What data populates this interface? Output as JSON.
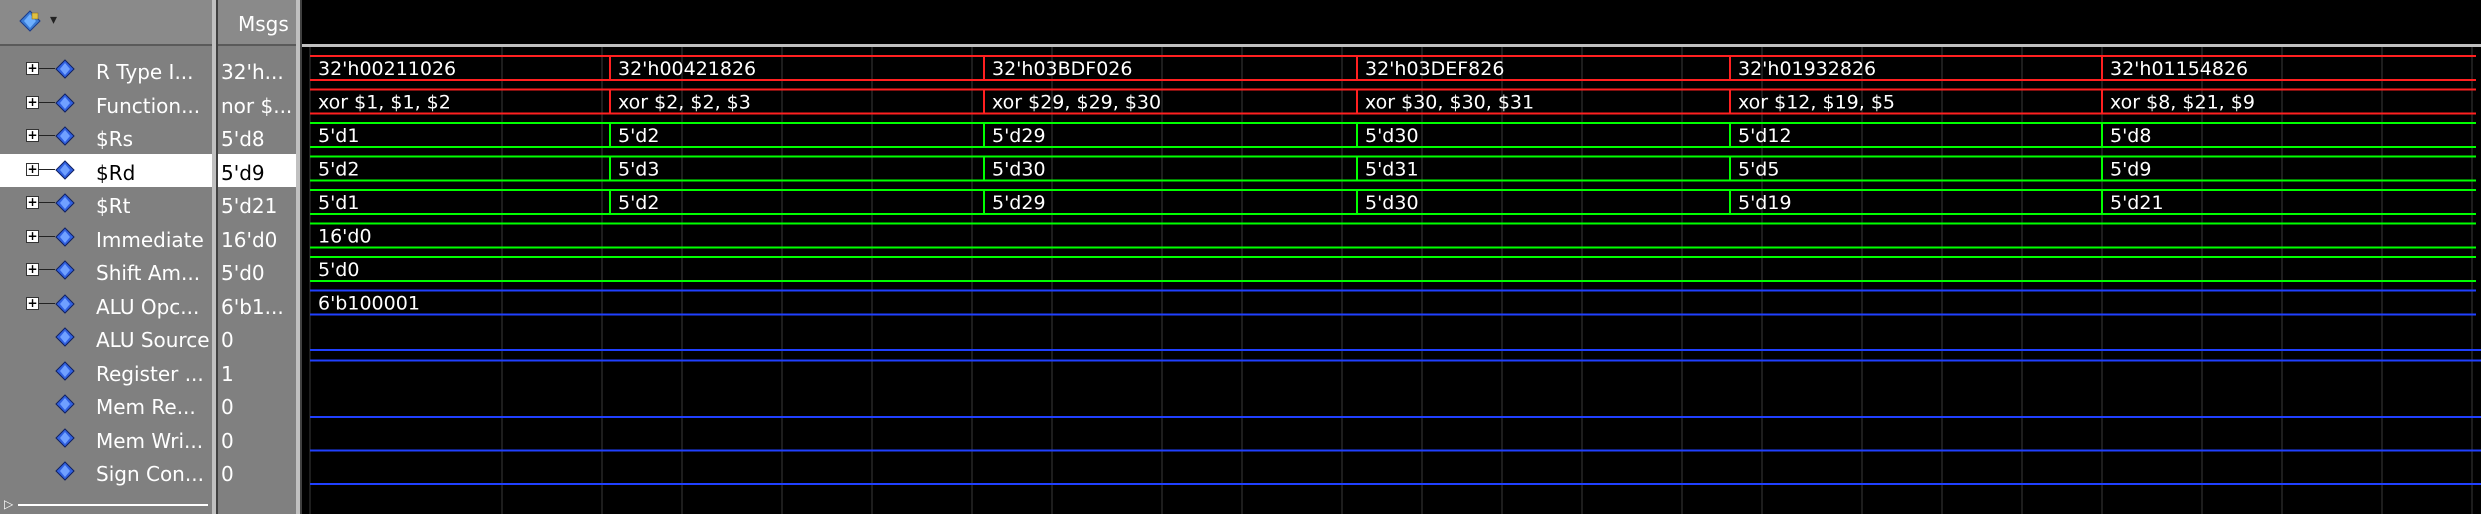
{
  "header": {
    "msgs_label": "Msgs",
    "toolbar_icon": "wave-diamond-icon"
  },
  "signals": [
    {
      "name": "R Type I...",
      "value": "32'h...",
      "expandable": true,
      "color": "#ff2020"
    },
    {
      "name": "Function...",
      "value": "nor $...",
      "expandable": true,
      "color": "#ff2020"
    },
    {
      "name": "$Rs",
      "value": "5'd8",
      "expandable": true,
      "color": "#00ff00"
    },
    {
      "name": "$Rd",
      "value": "5'd9",
      "expandable": true,
      "color": "#00ff00",
      "selected": true
    },
    {
      "name": "$Rt",
      "value": "5'd21",
      "expandable": true,
      "color": "#00ff00"
    },
    {
      "name": "Immediate",
      "value": "16'd0",
      "expandable": true,
      "color": "#00ff00"
    },
    {
      "name": "Shift Am...",
      "value": "5'd0",
      "expandable": true,
      "color": "#00ff00"
    },
    {
      "name": "ALU Opc...",
      "value": "6'b1...",
      "expandable": true,
      "color": "#2040ff"
    },
    {
      "name": "ALU Source",
      "value": "0",
      "expandable": false,
      "color": "#2040ff"
    },
    {
      "name": "Register ...",
      "value": "1",
      "expandable": false,
      "color": "#2040ff"
    },
    {
      "name": "Mem Re...",
      "value": "0",
      "expandable": false,
      "color": "#2040ff"
    },
    {
      "name": "Mem Wri...",
      "value": "0",
      "expandable": false,
      "color": "#2040ff"
    },
    {
      "name": "Sign Con...",
      "value": "0",
      "expandable": false,
      "color": "#2040ff"
    }
  ],
  "waves": [
    {
      "color": "#ff2020",
      "segments": [
        "32'h00211026",
        "32'h00421826",
        "32'h03BDF026",
        "32'h03DEF826",
        "32'h01932826",
        "32'h01154826"
      ]
    },
    {
      "color": "#ff2020",
      "segments": [
        "xor $1, $1, $2",
        "xor $2, $2, $3",
        "xor $29, $29, $30",
        "xor $30, $30, $31",
        "xor $12, $19, $5",
        "xor $8, $21, $9"
      ]
    },
    {
      "color": "#00ff00",
      "segments": [
        "5'd1",
        "5'd2",
        "5'd29",
        "5'd30",
        "5'd12",
        "5'd8"
      ]
    },
    {
      "color": "#00ff00",
      "segments": [
        "5'd2",
        "5'd3",
        "5'd30",
        "5'd31",
        "5'd5",
        "5'd9"
      ]
    },
    {
      "color": "#00ff00",
      "segments": [
        "5'd1",
        "5'd2",
        "5'd29",
        "5'd30",
        "5'd19",
        "5'd21"
      ]
    },
    {
      "color": "#00ff00",
      "segments": [
        "16'd0"
      ]
    },
    {
      "color": "#00ff00",
      "segments": [
        "5'd0"
      ]
    },
    {
      "color": "#2040ff",
      "segments": [
        "6'b100001"
      ]
    },
    {
      "color": "#2040ff",
      "level": 0
    },
    {
      "color": "#2040ff",
      "level": 1
    },
    {
      "color": "#2040ff",
      "level": 0
    },
    {
      "color": "#2040ff",
      "level": 0
    },
    {
      "color": "#2040ff",
      "level": 0
    }
  ]
}
